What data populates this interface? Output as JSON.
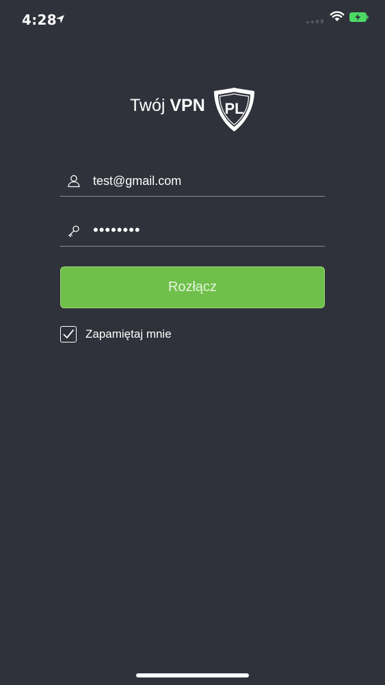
{
  "status_bar": {
    "time": "4:28",
    "icons": [
      "location-arrow-icon",
      "cellular-signal-icon",
      "wifi-icon",
      "battery-charging-icon"
    ],
    "battery_color": "#4cd964"
  },
  "logo": {
    "text_light": "Twój",
    "text_bold": "VPN",
    "badge_text": "PL"
  },
  "form": {
    "email": {
      "value": "test@gmail.com",
      "icon": "user-icon"
    },
    "password": {
      "value": "••••••••",
      "icon": "key-icon"
    },
    "button_label": "Rozłącz",
    "remember": {
      "label": "Zapamiętaj mnie",
      "checked": true
    }
  },
  "colors": {
    "background": "#30323b",
    "accent": "#6fc04a"
  }
}
